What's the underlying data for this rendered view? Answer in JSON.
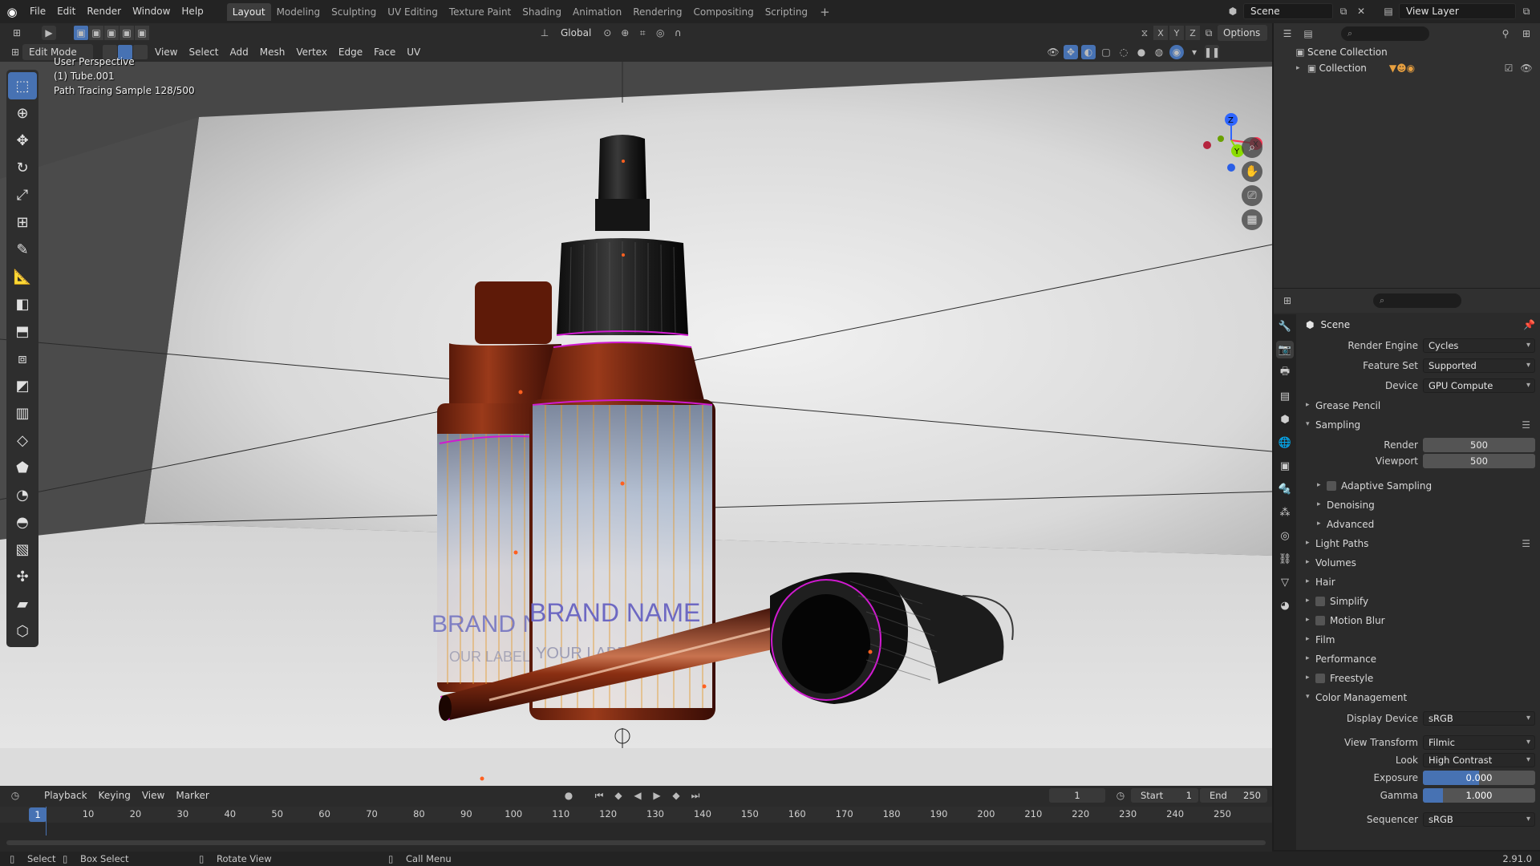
{
  "topbar": {
    "menus": [
      "File",
      "Edit",
      "Render",
      "Window",
      "Help"
    ],
    "workspaces": [
      "Layout",
      "Modeling",
      "Sculpting",
      "UV Editing",
      "Texture Paint",
      "Shading",
      "Animation",
      "Rendering",
      "Compositing",
      "Scripting"
    ],
    "active_workspace": "Layout",
    "scene_name": "Scene",
    "view_layer": "View Layer"
  },
  "viewport_header": {
    "transform_orientation": "Global",
    "axes": [
      "X",
      "Y",
      "Z"
    ],
    "options_label": "Options",
    "mode": "Edit Mode",
    "menus": [
      "View",
      "Select",
      "Add",
      "Mesh",
      "Vertex",
      "Edge",
      "Face",
      "UV"
    ]
  },
  "viewport": {
    "perspective": "User Perspective",
    "object": "(1) Tube.001",
    "render_status": "Path Tracing Sample 128/500",
    "label_brand": "BRAND NAME",
    "label_sub": "YOUR LABEL HERE",
    "label_brand_back": "BRAND NA",
    "label_sub_back": "OUR LABEL H",
    "gizmo": {
      "z": "Z",
      "y": "Y",
      "x": "X"
    }
  },
  "outliner": {
    "root": "Scene Collection",
    "collection": "Collection"
  },
  "properties": {
    "context": "Scene",
    "render_engine": {
      "label": "Render Engine",
      "value": "Cycles"
    },
    "feature_set": {
      "label": "Feature Set",
      "value": "Supported"
    },
    "device": {
      "label": "Device",
      "value": "GPU Compute"
    },
    "grease_pencil": "Grease Pencil",
    "sampling": "Sampling",
    "render_samples": {
      "label": "Render",
      "value": "500"
    },
    "viewport_samples": {
      "label": "Viewport",
      "value": "500"
    },
    "adaptive_sampling": "Adaptive Sampling",
    "denoising": "Denoising",
    "advanced": "Advanced",
    "light_paths": "Light Paths",
    "volumes": "Volumes",
    "hair": "Hair",
    "simplify": "Simplify",
    "motion_blur": "Motion Blur",
    "film": "Film",
    "performance": "Performance",
    "freestyle": "Freestyle",
    "color_management": "Color Management",
    "display_device": {
      "label": "Display Device",
      "value": "sRGB"
    },
    "view_transform": {
      "label": "View Transform",
      "value": "Filmic"
    },
    "look": {
      "label": "Look",
      "value": "High Contrast"
    },
    "exposure": {
      "label": "Exposure",
      "value": "0.000",
      "fill": 0.5
    },
    "gamma": {
      "label": "Gamma",
      "value": "1.000",
      "fill": 0.18
    },
    "sequencer": {
      "label": "Sequencer",
      "value": "sRGB"
    }
  },
  "timeline": {
    "menus": [
      "Playback",
      "Keying",
      "View",
      "Marker"
    ],
    "current_frame": "1",
    "start_label": "Start",
    "start": "1",
    "end_label": "End",
    "end": "250",
    "ticks": [
      "1",
      "10",
      "20",
      "30",
      "40",
      "50",
      "60",
      "70",
      "80",
      "90",
      "100",
      "110",
      "120",
      "130",
      "140",
      "150",
      "160",
      "170",
      "180",
      "190",
      "200",
      "210",
      "220",
      "230",
      "240",
      "250"
    ]
  },
  "statusbar": {
    "select": "Select",
    "box_select": "Box Select",
    "rotate_view": "Rotate View",
    "call_menu": "Call Menu",
    "version": "2.91.0"
  }
}
